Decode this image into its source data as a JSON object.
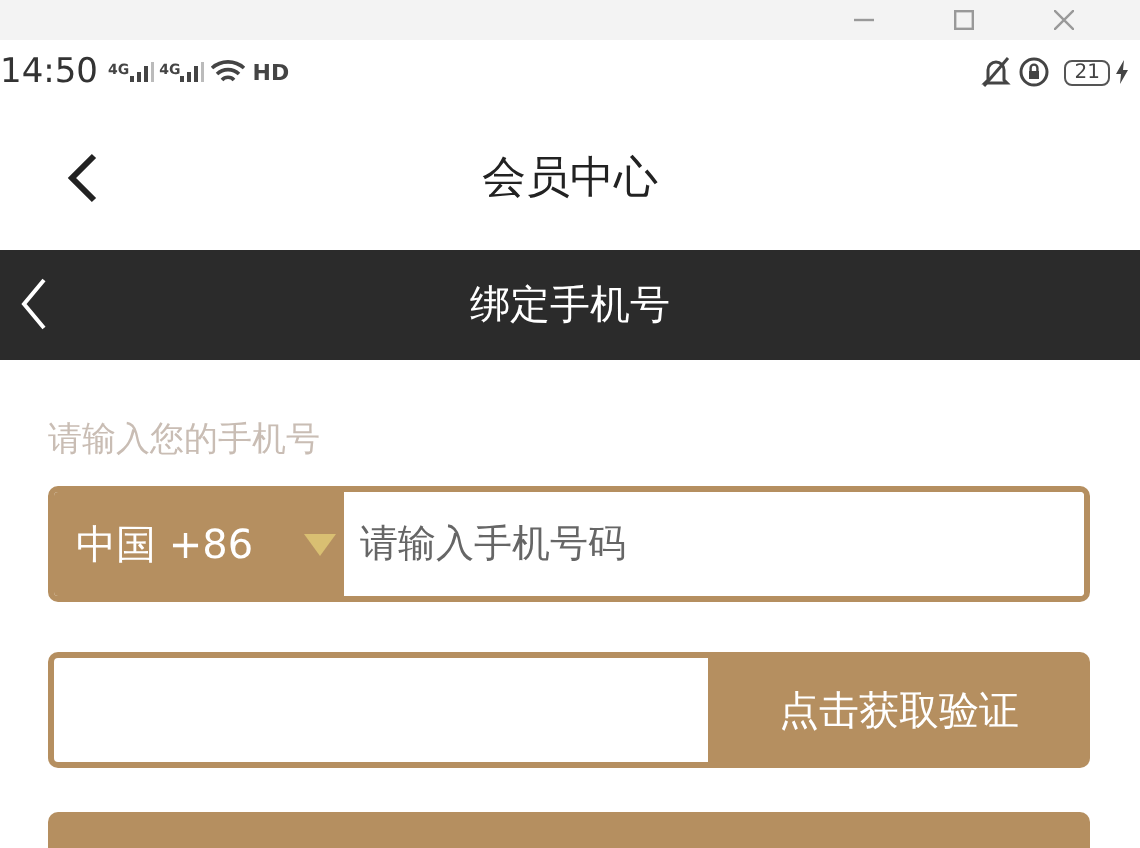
{
  "status_bar": {
    "time": "14:50",
    "signals": [
      "4G",
      "4G"
    ],
    "hd": "HD",
    "battery": "21"
  },
  "header": {
    "title": "会员中心"
  },
  "sub_header": {
    "title": "绑定手机号"
  },
  "form": {
    "label": "请输入您的手机号",
    "country": "中国 +86",
    "phone": {
      "placeholder": "请输入手机号码"
    },
    "code_button": "点击获取验证",
    "submit": {
      "kind": "button"
    }
  }
}
